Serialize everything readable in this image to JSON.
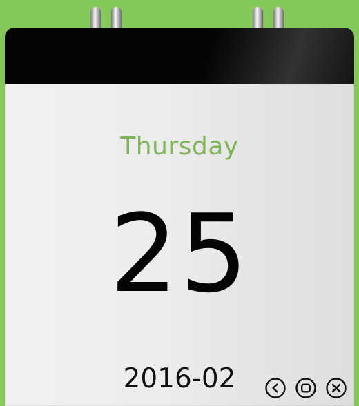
{
  "calendar": {
    "weekday": "Thursday",
    "day": "25",
    "year_month": "2016-02"
  },
  "controls": {
    "icons": {
      "back": "back-icon",
      "restore": "restore-icon",
      "close": "close-icon"
    }
  },
  "colors": {
    "background": "#86c95b",
    "header": "#050505",
    "weekday": "#7fb655",
    "day": "#050505",
    "paper_light": "#f1f1f1",
    "paper_dark": "#dedede"
  }
}
